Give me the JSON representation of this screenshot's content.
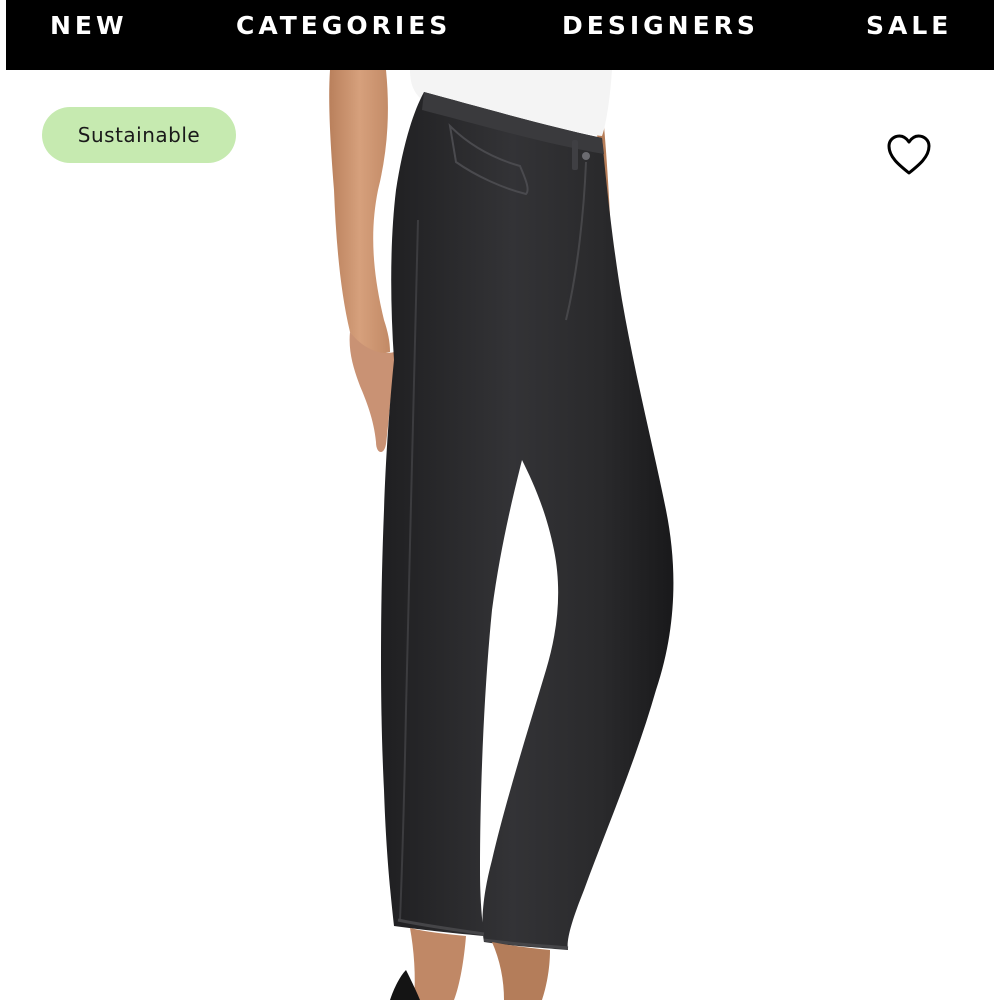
{
  "nav": {
    "items": [
      {
        "label": "NEW"
      },
      {
        "label": "CATEGORIES"
      },
      {
        "label": "DESIGNERS"
      },
      {
        "label": "SALE"
      }
    ]
  },
  "product": {
    "badge": "Sustainable",
    "image_alt": "Black high-rise straight leg jeans worn by model, side view",
    "wishlist_icon": "heart-outline-icon"
  },
  "colors": {
    "nav_bg": "#000000",
    "nav_text": "#ffffff",
    "badge_bg": "#c6eab0",
    "denim": "#2b2b2d"
  }
}
